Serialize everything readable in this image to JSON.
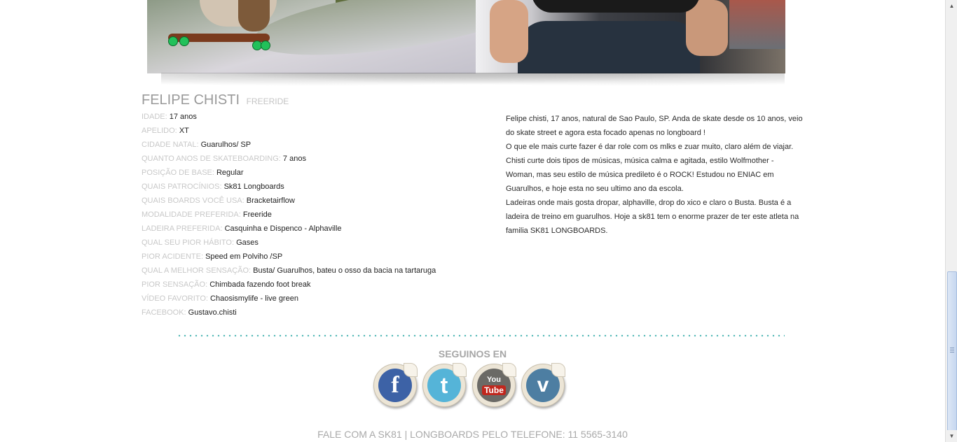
{
  "profile": {
    "name": "FELIPE CHISTI",
    "category": "FREERIDE",
    "info": [
      {
        "label": "IDADE:",
        "value": "17 anos"
      },
      {
        "label": "APELIDO:",
        "value": "XT"
      },
      {
        "label": "CIDADE NATAL:",
        "value": "Guarulhos/ SP"
      },
      {
        "label": "QUANTO ANOS DE SKATEBOARDING:",
        "value": "7 anos"
      },
      {
        "label": "POSIÇÃO DE BASE:",
        "value": "Regular"
      },
      {
        "label": "QUAIS PATROCÍNIOS:",
        "value": "Sk81 Longboards"
      },
      {
        "label": "QUAIS BOARDS VOCÊ USA:",
        "value": "Bracketairflow"
      },
      {
        "label": "MODALIDADE PREFERIDA:",
        "value": "Freeride"
      },
      {
        "label": "LADEIRA PREFERIDA:",
        "value": "Casquinha e Dispenco - Alphaville"
      },
      {
        "label": "QUAL SEU PIOR HÁBITO:",
        "value": "Gases"
      },
      {
        "label": "PIOR ACIDENTE:",
        "value": "Speed em Polviho /SP"
      },
      {
        "label": "QUAL A MELHOR SENSAÇÃO:",
        "value": "Busta/ Guarulhos, bateu o osso da bacia na tartaruga"
      },
      {
        "label": "PIOR SENSAÇÃO:",
        "value": "Chimbada fazendo foot break"
      },
      {
        "label": "VÍDEO FAVORITO:",
        "value": "Chaosismylife - live green"
      },
      {
        "label": "FACEBOOK:",
        "value": "Gustavo.chisti"
      }
    ],
    "bio": [
      "Felipe chisti, 17 anos, natural de Sao Paulo, SP. Anda de skate desde os 10 anos, veio do skate street e agora esta focado apenas no longboard !",
      "O que ele mais curte fazer é dar role com os mlks e zuar muito, claro além de viajar. Chisti curte dois tipos de músicas, música calma e agitada, estilo Wolfmother - Woman, mas seu estilo de música predileto é o ROCK! Estudou no ENIAC em Guarulhos, e hoje esta no seu ultimo ano da escola.",
      "Ladeiras onde mais gosta dropar, alphaville, drop do xico e claro o Busta. Busta é a ladeira de treino em guarulhos. Hoje a sk81 tem o enorme prazer de ter este atleta na familia SK81 LONGBOARDS."
    ]
  },
  "follow": {
    "title": "SEGUINOS EN",
    "icons": [
      "facebook-icon",
      "twitter-icon",
      "youtube-icon",
      "vimeo-icon"
    ],
    "fb_glyph": "f",
    "tw_glyph": "t",
    "yt_top": "You",
    "yt_bottom": "Tube",
    "vm_glyph": "v"
  },
  "footer": {
    "text": "FALE COM A SK81 | LONGBOARDS PELO TELEFONE: 11 5565-3140"
  },
  "colors": {
    "divider": "#4fb7b4",
    "facebook": "#3d62a6",
    "twitter": "#55b4d8",
    "youtube": "#c1271d",
    "vimeo": "#4d7ea2"
  }
}
